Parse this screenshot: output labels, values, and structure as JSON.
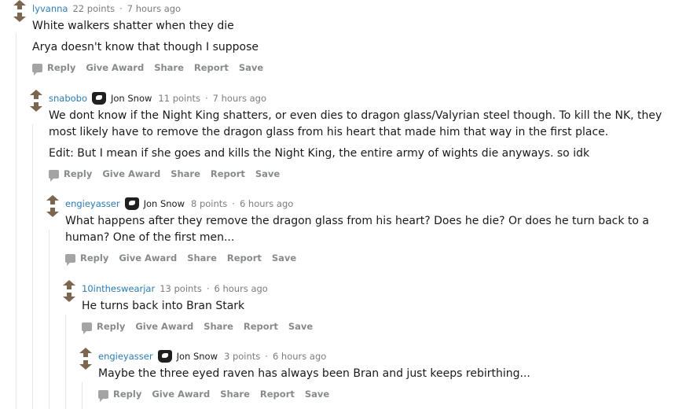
{
  "actions": {
    "reply": "Reply",
    "give_award": "Give Award",
    "share": "Share",
    "report": "Report",
    "save": "Save"
  },
  "dot": "·",
  "comments": [
    {
      "author": "lyvanna",
      "flair": "",
      "points": "22 points",
      "time": "7 hours ago",
      "body": [
        "White walkers shatter when they die",
        "Arya doesn't know that though I suppose"
      ]
    },
    {
      "author": "snabobo",
      "flair": "Jon Snow",
      "flair_icon": "direwolf-sigil-icon",
      "points": "11 points",
      "time": "7 hours ago",
      "body": [
        "We dont know if the Night King shatters, or even dies to dragon glass/Valyrian steel though. To kill the NK, they most likely have to remove the dragon glass from his heart that made him that way in the first place.",
        "Edit: But I mean if she goes and kills the Night King, the entire army of wights die anyways. so idk"
      ]
    },
    {
      "author": "engieyasser",
      "flair": "Jon Snow",
      "flair_icon": "direwolf-sigil-icon",
      "points": "8 points",
      "time": "6 hours ago",
      "body": [
        "What happens after they remove the dragon glass from his heart? Does he die? Or does he turn back to a human? One of the first men..."
      ]
    },
    {
      "author": "10intheswearjar",
      "flair": "",
      "points": "13 points",
      "time": "6 hours ago",
      "body": [
        "He turns back into Bran Stark"
      ]
    },
    {
      "author": "engieyasser",
      "flair": "Jon Snow",
      "flair_icon": "direwolf-sigil-icon",
      "points": "3 points",
      "time": "6 hours ago",
      "body": [
        "Maybe the three eyed raven has always been Bran and just keeps rebirthing..."
      ]
    }
  ]
}
